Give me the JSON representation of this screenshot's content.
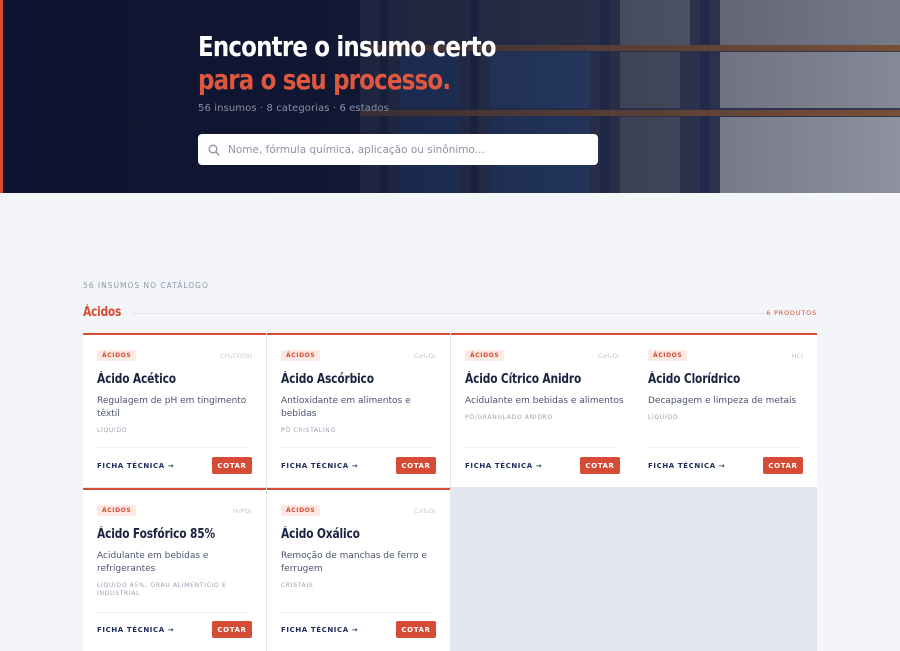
{
  "hero": {
    "title_line1": "Encontre o insumo certo",
    "title_line2": "para o seu processo.",
    "meta": "56 insumos · 8 categorias · 6 estados",
    "search_placeholder": "Nome, fórmula química, aplicação ou sinônimo..."
  },
  "catalog": {
    "count_label": "56 INSUMOS NO CATÁLOGO",
    "section_title": "Ácidos",
    "section_count": "6 PRODUTOS"
  },
  "products": [
    {
      "badge": "ÁCIDOS",
      "formula": "CH₃COOH",
      "name": "Ácido Acético",
      "description": "Regulagem de pH em tingimento têxtil",
      "form": "LÍQUIDO",
      "ficha": "FICHA TÉCNICA →",
      "cotar": "COTAR"
    },
    {
      "badge": "ÁCIDOS",
      "formula": "C₆H₈O₆",
      "name": "Ácido Ascórbico",
      "description": "Antioxidante em alimentos e bebidas",
      "form": "PÓ CRISTALINO",
      "ficha": "FICHA TÉCNICA →",
      "cotar": "COTAR"
    },
    {
      "badge": "ÁCIDOS",
      "formula": "C₆H₈O₇",
      "name": "Ácido Cítrico Anidro",
      "description": "Acidulante em bebidas e alimentos",
      "form": "PÓ/GRANULADO ANIDRO",
      "ficha": "FICHA TÉCNICA →",
      "cotar": "COTAR"
    },
    {
      "badge": "ÁCIDOS",
      "formula": "HCl",
      "name": "Ácido Clorídrico",
      "description": "Decapagem e limpeza de metais",
      "form": "LÍQUIDO",
      "ficha": "FICHA TÉCNICA →",
      "cotar": "COTAR"
    },
    {
      "badge": "ÁCIDOS",
      "formula": "H₃PO₄",
      "name": "Ácido Fosfórico 85%",
      "description": "Acidulante em bebidas e refrigerantes",
      "form": "LÍQUIDO 85%, GRAU ALIMENTÍCIO E INDUSTRIAL",
      "ficha": "FICHA TÉCNICA →",
      "cotar": "COTAR"
    },
    {
      "badge": "ÁCIDOS",
      "formula": "C₂H₂O₄",
      "name": "Ácido Oxálico",
      "description": "Remoção de manchas de ferro e ferrugem",
      "form": "CRISTAIS",
      "ficha": "FICHA TÉCNICA →",
      "cotar": "COTAR"
    }
  ],
  "colors": {
    "accent": "#d64b35",
    "navy": "#0f1530",
    "card_bg": "#ffffff",
    "page_bg": "#f3f5f9"
  },
  "icons": {
    "search": "search-icon"
  }
}
